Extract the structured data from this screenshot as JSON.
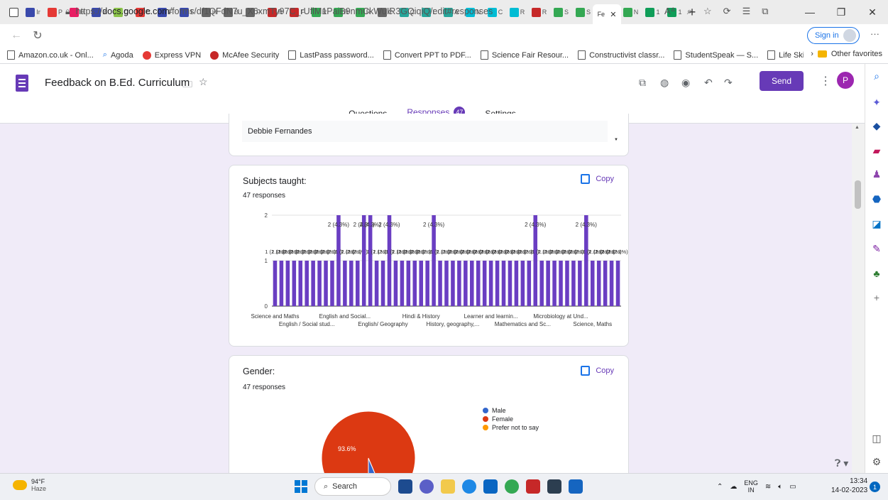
{
  "browser": {
    "tab_letters": [
      "Ir",
      "P",
      "H",
      "Ir",
      "C",
      "C",
      "F",
      "F",
      "H",
      "B",
      "P",
      "R",
      "F",
      "R",
      "R",
      "R",
      "C",
      "C",
      "L",
      "A",
      "N",
      "C",
      "R",
      "R",
      "S",
      "S"
    ],
    "active_tab_label": "Fe",
    "after_active_tab_letters": [
      "N",
      "1",
      "1"
    ],
    "url_prefix": "https://",
    "url_host": "docs.google.com",
    "url_path": "/forms/d/1QFdN7u_X6xmTy97C_rUflM1PaiB9nmCkWuIR3GQiqiQ/edit#responses",
    "sign_in": "Sign in",
    "favorites": [
      "Amazon.co.uk - Onl...",
      "Agoda",
      "Express VPN",
      "McAfee Security",
      "LastPass password...",
      "Convert PPT to PDF...",
      "Science Fair Resour...",
      "Constructivist classr...",
      "StudentSpeak — S...",
      "Life Skills Handboo..."
    ],
    "other_favorites": "Other favorites"
  },
  "form": {
    "title": "Feedback on B.Ed. Curriculum",
    "send_label": "Send",
    "profile_initial": "P",
    "tabs": {
      "questions": "Questions",
      "responses": "Responses",
      "responses_count": "47",
      "settings": "Settings"
    }
  },
  "name_card": {
    "answer": "Debbie Fernandes"
  },
  "subjects_card": {
    "title": "Subjects taught:",
    "responses": "47 responses",
    "copy_label": "Copy"
  },
  "gender_card": {
    "title": "Gender:",
    "responses": "47 responses",
    "copy_label": "Copy"
  },
  "colors": {
    "accent": "#673ab7",
    "bar": "#6a3ec2",
    "male": "#3366cc",
    "female": "#dc3912",
    "prefer_not": "#ff9900"
  },
  "chart_data": [
    {
      "type": "bar",
      "title": "Subjects taught:",
      "ylim": [
        0,
        2
      ],
      "yticks": [
        0,
        1,
        2
      ],
      "grid": true,
      "values": [
        1,
        1,
        1,
        1,
        1,
        1,
        1,
        1,
        1,
        1,
        2,
        1,
        1,
        1,
        2,
        2,
        1,
        1,
        2,
        1,
        1,
        1,
        1,
        1,
        1,
        2,
        1,
        1,
        1,
        1,
        1,
        1,
        1,
        1,
        1,
        1,
        1,
        1,
        1,
        1,
        1,
        2,
        1,
        1,
        1,
        1,
        1,
        1,
        1,
        2,
        1,
        1,
        1,
        1,
        1
      ],
      "value_label_one": "1 (2.1%)",
      "value_label_two": "2 (4.3%)",
      "x_labels_row1": [
        "Science and Maths",
        "English and Social...",
        "Hindi & History",
        "Learner and learnin...",
        "Microbiology at Und..."
      ],
      "x_labels_row2": [
        "English / Social stud...",
        "English/ Geography",
        "History, geography,...",
        "Mathematics and Sc...",
        "Science, Maths"
      ]
    },
    {
      "type": "pie",
      "title": "Gender:",
      "labels": [
        "Male",
        "Female",
        "Prefer not to say"
      ],
      "values": [
        6.4,
        93.6,
        0
      ],
      "slice_label": "93.6%",
      "legend": "right"
    }
  ],
  "taskbar": {
    "temp": "94°F",
    "condition": "Haze",
    "search": "Search",
    "lang1": "ENG",
    "lang2": "IN",
    "time": "13:34",
    "date": "14-02-2023"
  }
}
